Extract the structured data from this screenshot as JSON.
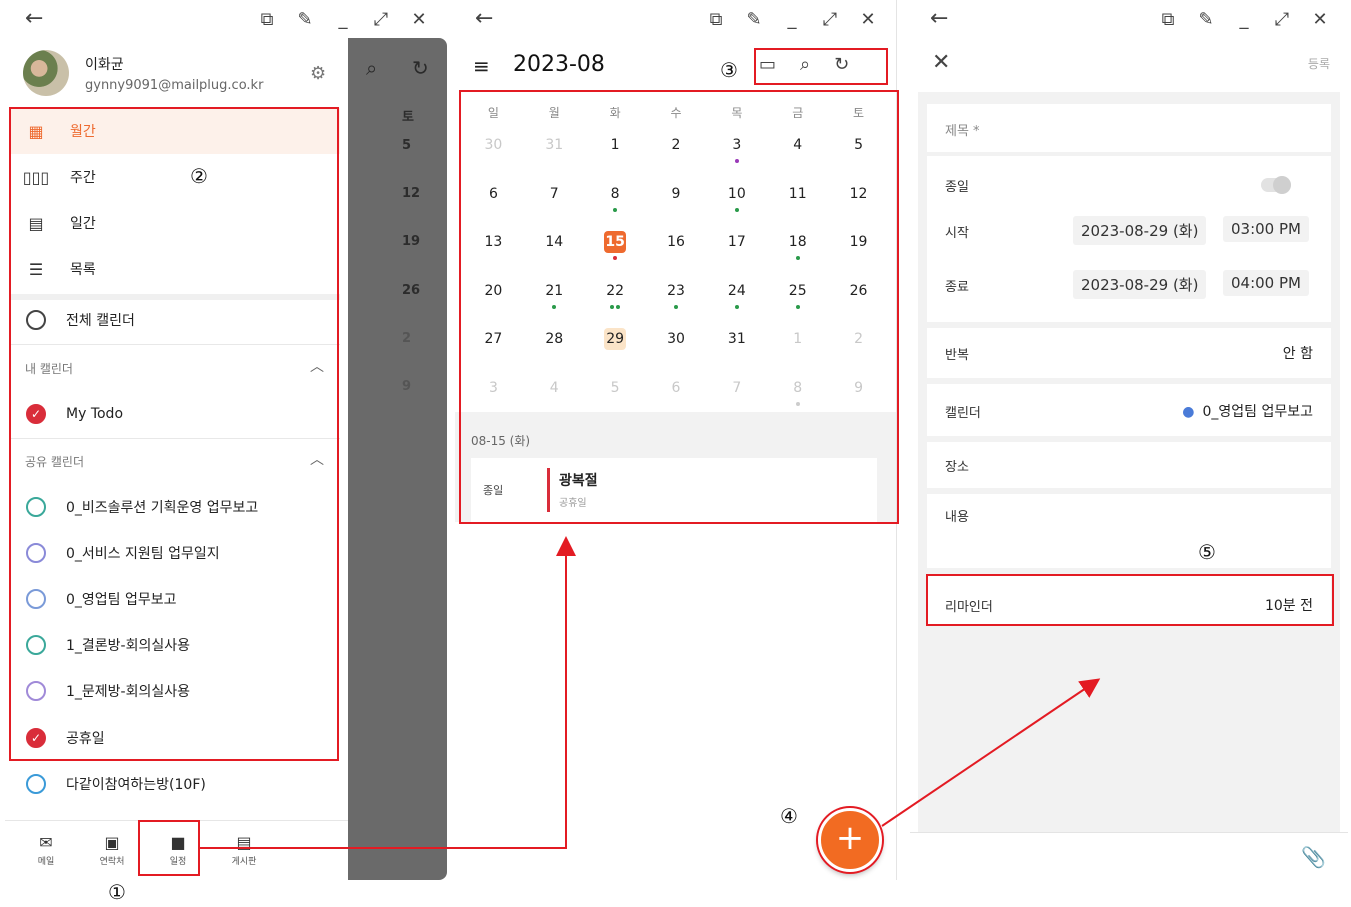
{
  "window": {
    "back": "←",
    "controls": [
      "⧉",
      "✎",
      "_",
      "⤢",
      "✕"
    ]
  },
  "panel1": {
    "profile": {
      "name": "이화균",
      "email": "gynny9091@mailplug.co.kr"
    },
    "views": [
      {
        "icon": "▦",
        "label": "월간"
      },
      {
        "icon": "▯▯▯",
        "label": "주간"
      },
      {
        "icon": "▤",
        "label": "일간"
      },
      {
        "icon": "☰",
        "label": "목록"
      }
    ],
    "all_calendars": "전체 캘린더",
    "my_calendars_header": "내 캘린더",
    "my_calendars": [
      {
        "label": "My Todo",
        "checked": true,
        "color": "#d92d3a"
      }
    ],
    "shared_header": "공유 캘린더",
    "shared_calendars": [
      {
        "label": "0_비즈솔루션 기획운영 업무보고",
        "color": "#3aa89a",
        "checked": false
      },
      {
        "label": "0_서비스 지원팀 업무일지",
        "color": "#8a8ad8",
        "checked": false
      },
      {
        "label": "0_영업팀 업무보고",
        "color": "#7a9ad8",
        "checked": false
      },
      {
        "label": "1_결론방-회의실사용",
        "color": "#3aa89a",
        "checked": false
      },
      {
        "label": "1_문제방-회의실사용",
        "color": "#a08ad8",
        "checked": false
      },
      {
        "label": "공휴일",
        "color": "#d92d3a",
        "checked": true
      },
      {
        "label": "다같이참여하는방(10F)",
        "color": "#3a9ad8",
        "checked": false
      }
    ],
    "bottom_nav": [
      {
        "icon": "✉",
        "label": "메일"
      },
      {
        "icon": "▣",
        "label": "연락처"
      },
      {
        "icon": "■",
        "label": "일정"
      },
      {
        "icon": "▤",
        "label": "게시판"
      }
    ],
    "behind": {
      "days": [
        "토",
        "5",
        "12",
        "19",
        "26",
        "2",
        "9"
      ]
    }
  },
  "panel2": {
    "title": "2023-08",
    "weekdays": [
      "일",
      "월",
      "화",
      "수",
      "목",
      "금",
      "토"
    ],
    "weeks": [
      [
        "30",
        "31",
        "1",
        "2",
        "3",
        "4",
        "5"
      ],
      [
        "6",
        "7",
        "8",
        "9",
        "10",
        "11",
        "12"
      ],
      [
        "13",
        "14",
        "15",
        "16",
        "17",
        "18",
        "19"
      ],
      [
        "20",
        "21",
        "22",
        "23",
        "24",
        "25",
        "26"
      ],
      [
        "27",
        "28",
        "29",
        "30",
        "31",
        "1",
        "2"
      ],
      [
        "3",
        "4",
        "5",
        "6",
        "7",
        "8",
        "9"
      ]
    ],
    "selected_date": "08-15 (화)",
    "event": {
      "tag": "종일",
      "title": "광복절",
      "subtitle": "공휴일"
    }
  },
  "panel3": {
    "save": "등록",
    "title_label": "제목 *",
    "allday_label": "종일",
    "start_label": "시작",
    "start_date": "2023-08-29 (화)",
    "start_time": "03:00 PM",
    "end_label": "종료",
    "end_date": "2023-08-29 (화)",
    "end_time": "04:00 PM",
    "repeat_label": "반복",
    "repeat_value": "안 함",
    "calendar_label": "캘린더",
    "calendar_value": "0_영업팀 업무보고",
    "place_label": "장소",
    "content_label": "내용",
    "reminder_label": "리마인더",
    "reminder_value": "10분 전"
  },
  "annotations": {
    "n1": "①",
    "n2": "②",
    "n3": "③",
    "n4": "④",
    "n5": "⑤"
  },
  "colors": {
    "accent": "#ee6a2f",
    "annotation": "#e31b23"
  }
}
